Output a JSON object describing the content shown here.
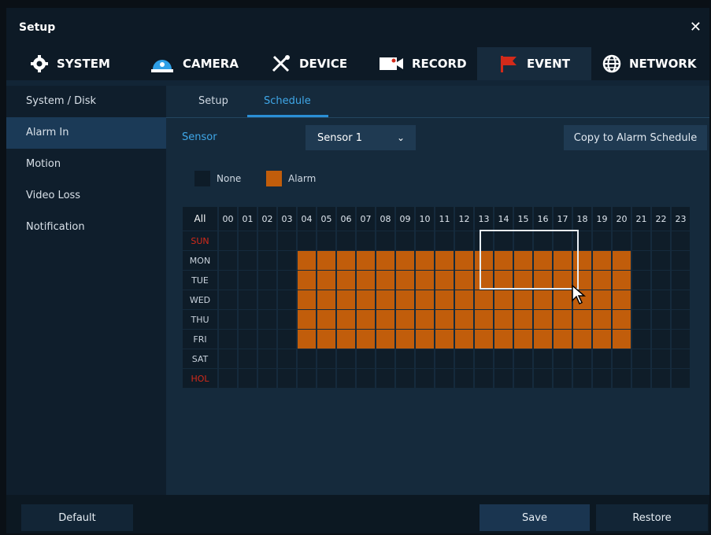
{
  "window": {
    "title": "Setup"
  },
  "tabs": [
    {
      "label": "SYSTEM",
      "icon": "gear-icon"
    },
    {
      "label": "CAMERA",
      "icon": "camera-icon"
    },
    {
      "label": "DEVICE",
      "icon": "tools-icon"
    },
    {
      "label": "RECORD",
      "icon": "record-icon"
    },
    {
      "label": "EVENT",
      "icon": "flag-icon"
    },
    {
      "label": "NETWORK",
      "icon": "globe-icon"
    }
  ],
  "active_tab": "EVENT",
  "sidebar": {
    "items": [
      {
        "label": "System / Disk"
      },
      {
        "label": "Alarm In"
      },
      {
        "label": "Motion"
      },
      {
        "label": "Video Loss"
      },
      {
        "label": "Notification"
      }
    ],
    "active": "Alarm In"
  },
  "subtabs": [
    {
      "label": "Setup"
    },
    {
      "label": "Schedule"
    }
  ],
  "active_subtab": "Schedule",
  "sensor": {
    "label": "Sensor",
    "value": "Sensor 1"
  },
  "copy_button": "Copy to Alarm Schedule",
  "legend": {
    "none": "None",
    "alarm": "Alarm"
  },
  "schedule": {
    "all_label": "All",
    "hours": [
      "00",
      "01",
      "02",
      "03",
      "04",
      "05",
      "06",
      "07",
      "08",
      "09",
      "10",
      "11",
      "12",
      "13",
      "14",
      "15",
      "16",
      "17",
      "18",
      "19",
      "20",
      "21",
      "22",
      "23"
    ],
    "days": [
      {
        "label": "SUN",
        "color": "#d32a1a",
        "alarm_hours": []
      },
      {
        "label": "MON",
        "color": "#c9d2dc",
        "alarm_hours": [
          4,
          5,
          6,
          7,
          8,
          9,
          10,
          11,
          12,
          13,
          14,
          15,
          16,
          17,
          18,
          19,
          20
        ]
      },
      {
        "label": "TUE",
        "color": "#c9d2dc",
        "alarm_hours": [
          4,
          5,
          6,
          7,
          8,
          9,
          10,
          11,
          12,
          13,
          14,
          15,
          16,
          17,
          18,
          19,
          20
        ]
      },
      {
        "label": "WED",
        "color": "#c9d2dc",
        "alarm_hours": [
          4,
          5,
          6,
          7,
          8,
          9,
          10,
          11,
          12,
          13,
          14,
          15,
          16,
          17,
          18,
          19,
          20
        ]
      },
      {
        "label": "THU",
        "color": "#c9d2dc",
        "alarm_hours": [
          4,
          5,
          6,
          7,
          8,
          9,
          10,
          11,
          12,
          13,
          14,
          15,
          16,
          17,
          18,
          19,
          20
        ]
      },
      {
        "label": "FRI",
        "color": "#c9d2dc",
        "alarm_hours": [
          4,
          5,
          6,
          7,
          8,
          9,
          10,
          11,
          12,
          13,
          14,
          15,
          16,
          17,
          18,
          19,
          20
        ]
      },
      {
        "label": "SAT",
        "color": "#c9d2dc",
        "alarm_hours": []
      },
      {
        "label": "HOL",
        "color": "#d32a1a",
        "alarm_hours": []
      }
    ],
    "colors": {
      "alarm": "#c15d0b",
      "none": "#0f1d29"
    }
  },
  "bottom": {
    "default": "Default",
    "save": "Save",
    "restore": "Restore"
  }
}
